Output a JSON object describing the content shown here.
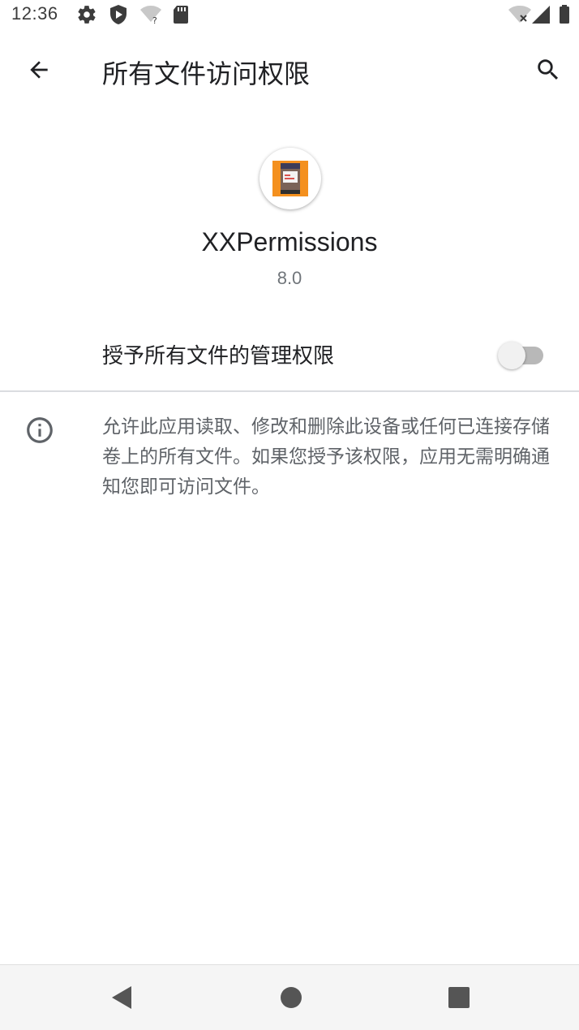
{
  "status_bar": {
    "time": "12:36",
    "icons_left": [
      "gear-icon",
      "shield-icon",
      "wifi-question-icon",
      "sd-card-icon"
    ],
    "icons_right": [
      "wifi-off-icon",
      "cellular-signal-icon",
      "battery-icon"
    ]
  },
  "app_bar": {
    "title": "所有文件访问权限",
    "back_icon": "arrow-back-icon",
    "search_icon": "search-icon"
  },
  "app_info": {
    "name": "XXPermissions",
    "version": "8.0",
    "icon": "app-logo-icon"
  },
  "permission_toggle": {
    "label": "授予所有文件的管理权限",
    "checked": false
  },
  "info": {
    "icon": "info-icon",
    "text": "允许此应用读取、修改和删除此设备或任何已连接存储卷上的所有文件。如果您授予该权限，应用无需明确通知您即可访问文件。"
  },
  "nav_bar": {
    "icons": [
      "nav-back-icon",
      "nav-home-icon",
      "nav-recents-icon"
    ]
  },
  "colors": {
    "background": "#ffffff",
    "text_primary": "#202124",
    "text_secondary": "#5f6368",
    "switch_off_track": "#b8b8b8",
    "nav_bar": "#f5f5f5",
    "app_icon_orange": "#f4901e"
  }
}
